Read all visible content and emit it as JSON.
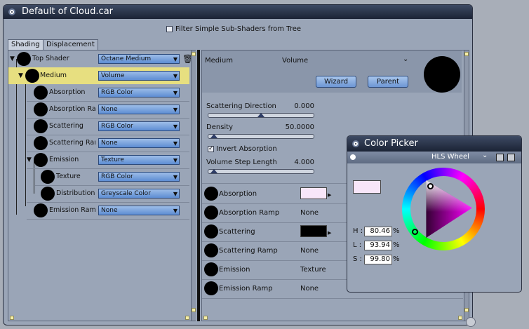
{
  "window": {
    "title": "Default of Cloud.car"
  },
  "filter": {
    "label": "Filter Simple Sub-Shaders from Tree"
  },
  "tabs": [
    {
      "label": "Shading"
    },
    {
      "label": "Displacement"
    }
  ],
  "tree": [
    {
      "name": "Top Shader",
      "value": "Octane Medium"
    },
    {
      "name": "Medium",
      "value": "Volume"
    },
    {
      "name": "Absorption",
      "value": "RGB Color"
    },
    {
      "name": "Absorption Ra",
      "value": "None"
    },
    {
      "name": "Scattering",
      "value": "RGB Color"
    },
    {
      "name": "Scattering Rar",
      "value": "None"
    },
    {
      "name": "Emission",
      "value": "Texture"
    },
    {
      "name": "Texture",
      "value": "RGB Color"
    },
    {
      "name": "Distribution",
      "value": "Greyscale Color"
    },
    {
      "name": "Emission Ram",
      "value": "None"
    }
  ],
  "right": {
    "header_label": "Medium",
    "header_value": "Volume",
    "wizard": "Wizard",
    "parent": "Parent",
    "sliders": [
      {
        "label": "Scattering Direction",
        "value": "0.000",
        "fraction": 0.5
      },
      {
        "label": "Density",
        "value": "50.0000",
        "fraction": 0.0
      }
    ],
    "invert_label": "Invert Absorption",
    "invert_checked": true,
    "step": {
      "label": "Volume Step Length",
      "value": "4.000",
      "fraction": 0.0
    },
    "props": [
      {
        "label": "Absorption",
        "value": "",
        "swatch": "#f8e6f9"
      },
      {
        "label": "Absorption Ramp",
        "value": "None"
      },
      {
        "label": "Scattering",
        "value": "",
        "swatch": "#000000"
      },
      {
        "label": "Scattering Ramp",
        "value": "None"
      },
      {
        "label": "Emission",
        "value": "Texture"
      },
      {
        "label": "Emission Ramp",
        "value": "None"
      }
    ]
  },
  "picker": {
    "title": "Color Picker",
    "mode": "HLS Wheel",
    "color": "#f8e6f9",
    "h_label": "H :",
    "h": "80.46",
    "h_unit": "%",
    "l_label": "L :",
    "l": "93.94",
    "l_unit": "%",
    "s_label": "S :",
    "s": "99.80",
    "s_unit": "%"
  },
  "colors": {
    "titlebar": "#1b2335",
    "selected_row": "#e7df80",
    "button": "#6d96d4"
  }
}
